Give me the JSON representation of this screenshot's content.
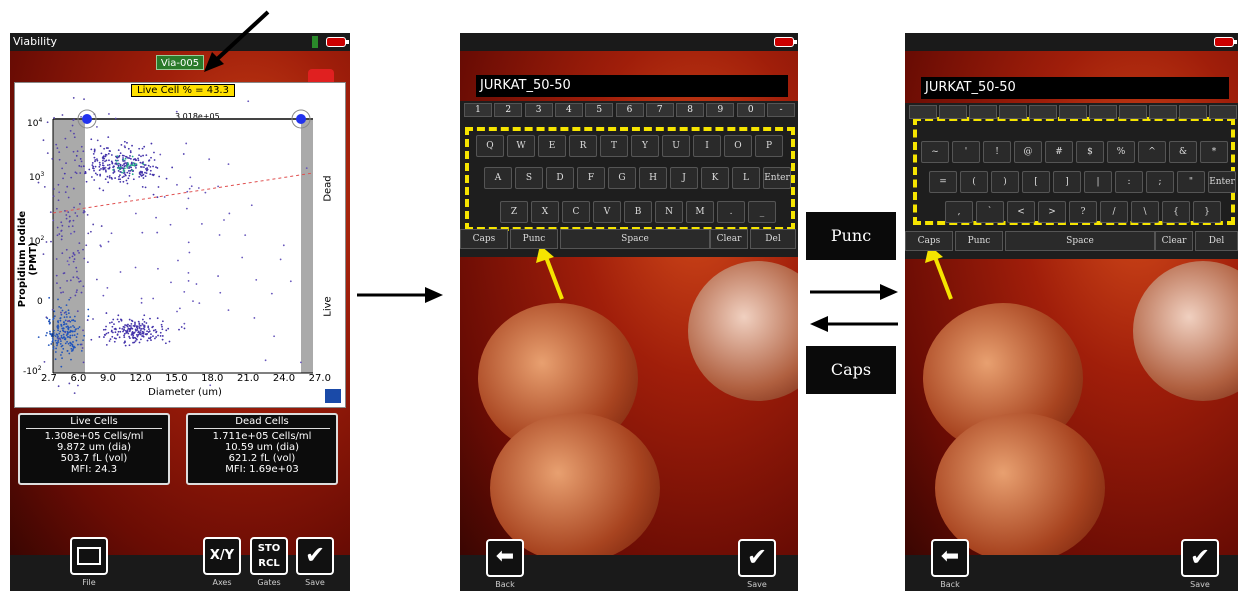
{
  "screen1": {
    "title": "Viability",
    "gate_name": "Via-005",
    "live_cell_pct": "Live Cell % = 43.3",
    "top_count": "3.018e+05",
    "ylabel": "Propidium Iodide (PMT)",
    "xlabel": "Diameter (um)",
    "xticks": [
      "2.7",
      "6.0",
      "9.0",
      "12.0",
      "15.0",
      "18.0",
      "21.0",
      "24.0",
      "27.0"
    ],
    "yticks": [
      "10",
      "10",
      "10",
      "0",
      "-10"
    ],
    "ytick_exp": [
      "4",
      "3",
      "2",
      "",
      "2"
    ],
    "dead_label": "Dead",
    "live_label": "Live",
    "live": {
      "header": "Live Cells",
      "lines": [
        "1.308e+05 Cells/ml",
        "9.872 um (dia)",
        "503.7 fL (vol)",
        "MFI:  24.3"
      ]
    },
    "dead": {
      "header": "Dead Cells",
      "lines": [
        "1.711e+05 Cells/ml",
        "10.59 um (dia)",
        "621.2 fL (vol)",
        "MFI: 1.69e+03"
      ]
    },
    "buttons": {
      "file": "File",
      "axes": "Axes",
      "gates": "Gates",
      "save": "Save",
      "xy": "X/Y",
      "sto": "STO",
      "rcl": "RCL"
    }
  },
  "screen2": {
    "input": "JURKAT_50-50",
    "numrow": [
      "1",
      "2",
      "3",
      "4",
      "5",
      "6",
      "7",
      "8",
      "9",
      "0",
      "-"
    ],
    "row1": [
      "Q",
      "W",
      "E",
      "R",
      "T",
      "Y",
      "U",
      "I",
      "O",
      "P"
    ],
    "row2": [
      "A",
      "S",
      "D",
      "F",
      "G",
      "H",
      "J",
      "K",
      "L",
      "Enter"
    ],
    "row3": [
      "Z",
      "X",
      "C",
      "V",
      "B",
      "N",
      "M",
      ".",
      "_"
    ],
    "fn": [
      "Caps",
      "Punc",
      "Space",
      "Clear",
      "Del"
    ],
    "back": "Back",
    "save": "Save"
  },
  "screen3": {
    "input": "JURKAT_50-50",
    "row1": [
      "~",
      "'",
      "!",
      "@",
      "#",
      "$",
      "%",
      "^",
      "&",
      "*"
    ],
    "row2": [
      "=",
      "(",
      ")",
      "[",
      "]",
      "|",
      ":",
      ";",
      "\"",
      "Enter"
    ],
    "row3": [
      ",",
      "`",
      "<",
      ">",
      "?",
      "/",
      "\\",
      "{",
      "}"
    ],
    "fn": [
      "Caps",
      "Punc",
      "Space",
      "Clear",
      "Del"
    ],
    "back": "Back",
    "save": "Save"
  },
  "labels": {
    "punc": "Punc",
    "caps": "Caps"
  },
  "chart_data": {
    "type": "scatter",
    "xlabel": "Diameter (um)",
    "ylabel": "Propidium Iodide (PMT)",
    "xlim": [
      2.7,
      27.0
    ],
    "series": [
      {
        "name": "Dead",
        "center": [
          9.5,
          1000
        ]
      },
      {
        "name": "Live",
        "center": [
          10.0,
          0
        ]
      }
    ]
  },
  "colors": {
    "accent_yellow": "#ffe000",
    "dash_yellow": "#f5e400",
    "gate_green": "#2a7a2a",
    "red": "#e02020"
  }
}
